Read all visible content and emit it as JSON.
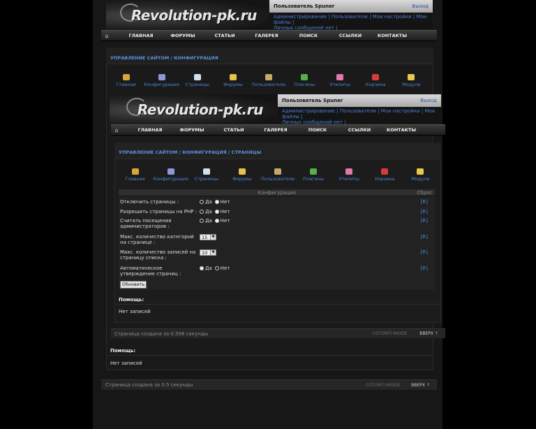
{
  "site": {
    "logo": "Revolution-pk.ru"
  },
  "outer": {
    "user": {
      "name": "Пользователь Spuner",
      "logout": "Выход",
      "links": "Администрирование | Пользователи | Мои настройки | Мои файлы |",
      "pm": "Личных сообщений нет |"
    },
    "nav": {
      "items": [
        "ГЛАВНАЯ",
        "ФОРУМЫ",
        "СТАТЬИ",
        "ГАЛЕРЕЯ",
        "ПОИСК",
        "ССЫЛКИ",
        "КОНТАКТЫ"
      ]
    },
    "breadcrumb": "УПРАВЛЕНИЕ САЙТОМ / КОНФИГУРАЦИЯ",
    "cp": [
      "Главная",
      "Конфигурация",
      "Страницы",
      "Форумы",
      "Пользователи",
      "Плагины",
      "Утилиты",
      "Корзина",
      "Модули"
    ],
    "help_title": "Помощь:",
    "help_text": "Нет записей",
    "footer": {
      "created": "Страница создана за 0.5 секунды",
      "powered": "COTONTI INSIDE",
      "up": "ВВЕРХ"
    }
  },
  "inner": {
    "user": {
      "name": "Пользователь Spuner",
      "logout": "Выход",
      "links": "Администрирование | Пользователи | Мои настройки | Мои файлы |",
      "pm": "Личных сообщений нет |"
    },
    "nav": {
      "items": [
        "ГЛАВНАЯ",
        "ФОРУМЫ",
        "СТАТЬИ",
        "ГАЛЕРЕЯ",
        "ПОИСК",
        "ССЫЛКИ",
        "КОНТАКТЫ"
      ]
    },
    "breadcrumb": "УПРАВЛЕНИЕ САЙТОМ / КОНФИГУРАЦИЯ / СТРАНИЦЫ",
    "cp": [
      "Главная",
      "Конфигурация",
      "Страницы",
      "Форумы",
      "Пользователи",
      "Плагины",
      "Утилиты",
      "Корзина",
      "Модули"
    ],
    "config": {
      "header": "Конфигурация",
      "reset_header": "Сброс",
      "rows": [
        {
          "label": "Отключить страницы :",
          "type": "radio",
          "yes": "Да",
          "no": "Нет",
          "reset": "[R]"
        },
        {
          "label": "Разрешить страницы на PHP :",
          "type": "radio",
          "yes": "Да",
          "no": "Нет",
          "reset": "[R]"
        },
        {
          "label": "Считать посещения администраторов :",
          "type": "radio",
          "yes": "Да",
          "no": "Нет",
          "reset": "[R]"
        },
        {
          "label": "Макс. количество категорий на странице :",
          "type": "select",
          "value": "15",
          "reset": "[R]"
        },
        {
          "label": "Макс. количество записей на страницу списка :",
          "type": "select",
          "value": "10",
          "reset": "[R]"
        },
        {
          "label": "Автоматическое утверждение страниц :",
          "type": "radio",
          "yes": "Да",
          "no": "Нет",
          "reset": "[R]"
        }
      ],
      "update": "Обновить"
    },
    "help_title": "Помощь:",
    "help_text": "Нет записей",
    "footer": {
      "created": "Страница создана за 0.506 секунды",
      "powered": "COTONTI INSIDE",
      "up": "ВВЕРХ"
    }
  },
  "colors": {
    "link": "#4a86d8",
    "crumb": "#5b92e0",
    "page": "#171717"
  }
}
